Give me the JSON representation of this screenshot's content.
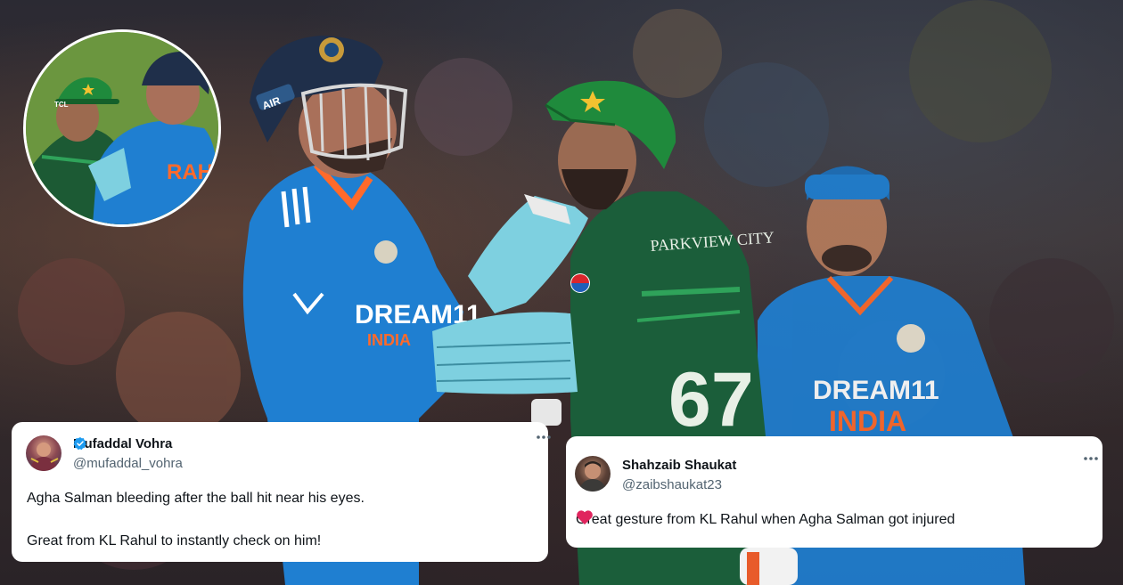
{
  "photo": {
    "jersey_left_brand": "DREAM11",
    "jersey_left_country": "INDIA",
    "jersey_middle_sponsor": "PARKVIEW CITY",
    "jersey_middle_number": "67",
    "jersey_right_brand": "DREAM11",
    "jersey_right_country": "INDIA",
    "helmet_sticker": "AIR",
    "inset_name": "RAH",
    "inset_logo": "TCL"
  },
  "tweets": [
    {
      "name": "Mufaddal Vohra",
      "handle": "@mufaddal_vohra",
      "verified": true,
      "line_1": "Agha Salman bleeding after the ball hit near his eyes.",
      "line_2": "Great from KL Rahul to instantly check on him!",
      "more_icon": "more-horizontal-icon"
    },
    {
      "name": "Shahzaib Shaukat",
      "handle": "@zaibshaukat23",
      "verified": false,
      "line_1": "Great gesture from KL Rahul when Agha Salman got injured",
      "emoji": "red-heart-icon",
      "more_icon": "more-horizontal-icon"
    }
  ],
  "colors": {
    "india_blue": "#1f7fd1",
    "pakistan_green": "#1b5e3a",
    "cap_green": "#1f8a3c",
    "verified_blue": "#1d9bf0",
    "heart_red": "#e0245e",
    "muted_text": "#536471"
  }
}
